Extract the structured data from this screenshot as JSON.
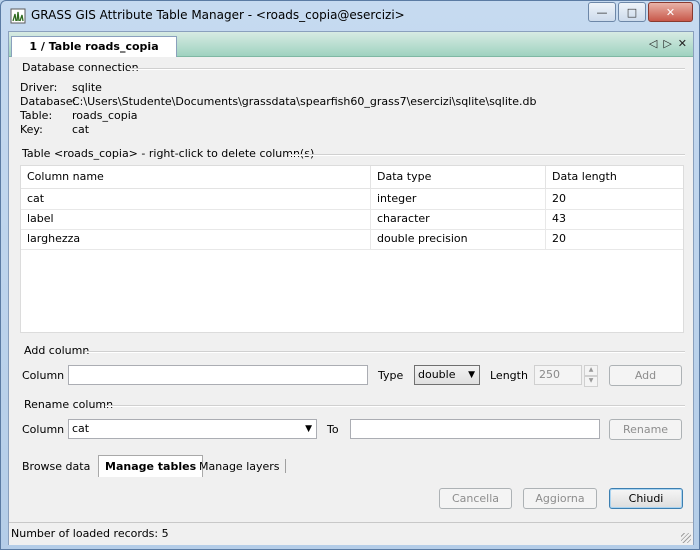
{
  "window": {
    "title": "GRASS GIS Attribute Table Manager - <roads_copia@esercizi>",
    "icon": "grass-app-icon",
    "buttons": {
      "minimize": "—",
      "maximize": "□",
      "close": "✕"
    }
  },
  "notebook": {
    "tab_label": "1 / Table roads_copia",
    "nav_left": "◁",
    "nav_right": "▷",
    "close": "✕"
  },
  "db_connection": {
    "group_title": "Database connection",
    "driver_label": "Driver:",
    "driver_value": "sqlite",
    "database_label": "Database:",
    "database_value": "C:\\Users\\Studente\\Documents\\grassdata\\spearfish60_grass7\\esercizi\\sqlite\\sqlite.db",
    "table_label": "Table:",
    "table_value": "roads_copia",
    "key_label": "Key:",
    "key_value": "cat"
  },
  "table_group": {
    "group_title": "Table <roads_copia> - right-click to delete column(s)",
    "columns": [
      "Column name",
      "Data type",
      "Data length"
    ],
    "rows": [
      [
        "cat",
        "integer",
        "20"
      ],
      [
        "label",
        "character",
        "43"
      ],
      [
        "larghezza",
        "double precision",
        "20"
      ]
    ]
  },
  "add_column": {
    "group_title": "Add column",
    "column_label": "Column",
    "column_value": "",
    "type_label": "Type",
    "type_value": "double",
    "length_label": "Length",
    "length_value": "250",
    "add_button": "Add"
  },
  "rename_column": {
    "group_title": "Rename column",
    "column_label": "Column",
    "column_value": "cat",
    "to_label": "To",
    "to_value": "",
    "rename_button": "Rename"
  },
  "bottom_tabs": {
    "browse": "Browse data",
    "manage_tables": "Manage tables",
    "manage_layers": "Manage layers",
    "active": "manage_tables"
  },
  "actions": {
    "cancel": "Cancella",
    "apply": "Aggiorna",
    "close": "Chiudi"
  },
  "status": {
    "text": "Number of loaded records: 5"
  }
}
